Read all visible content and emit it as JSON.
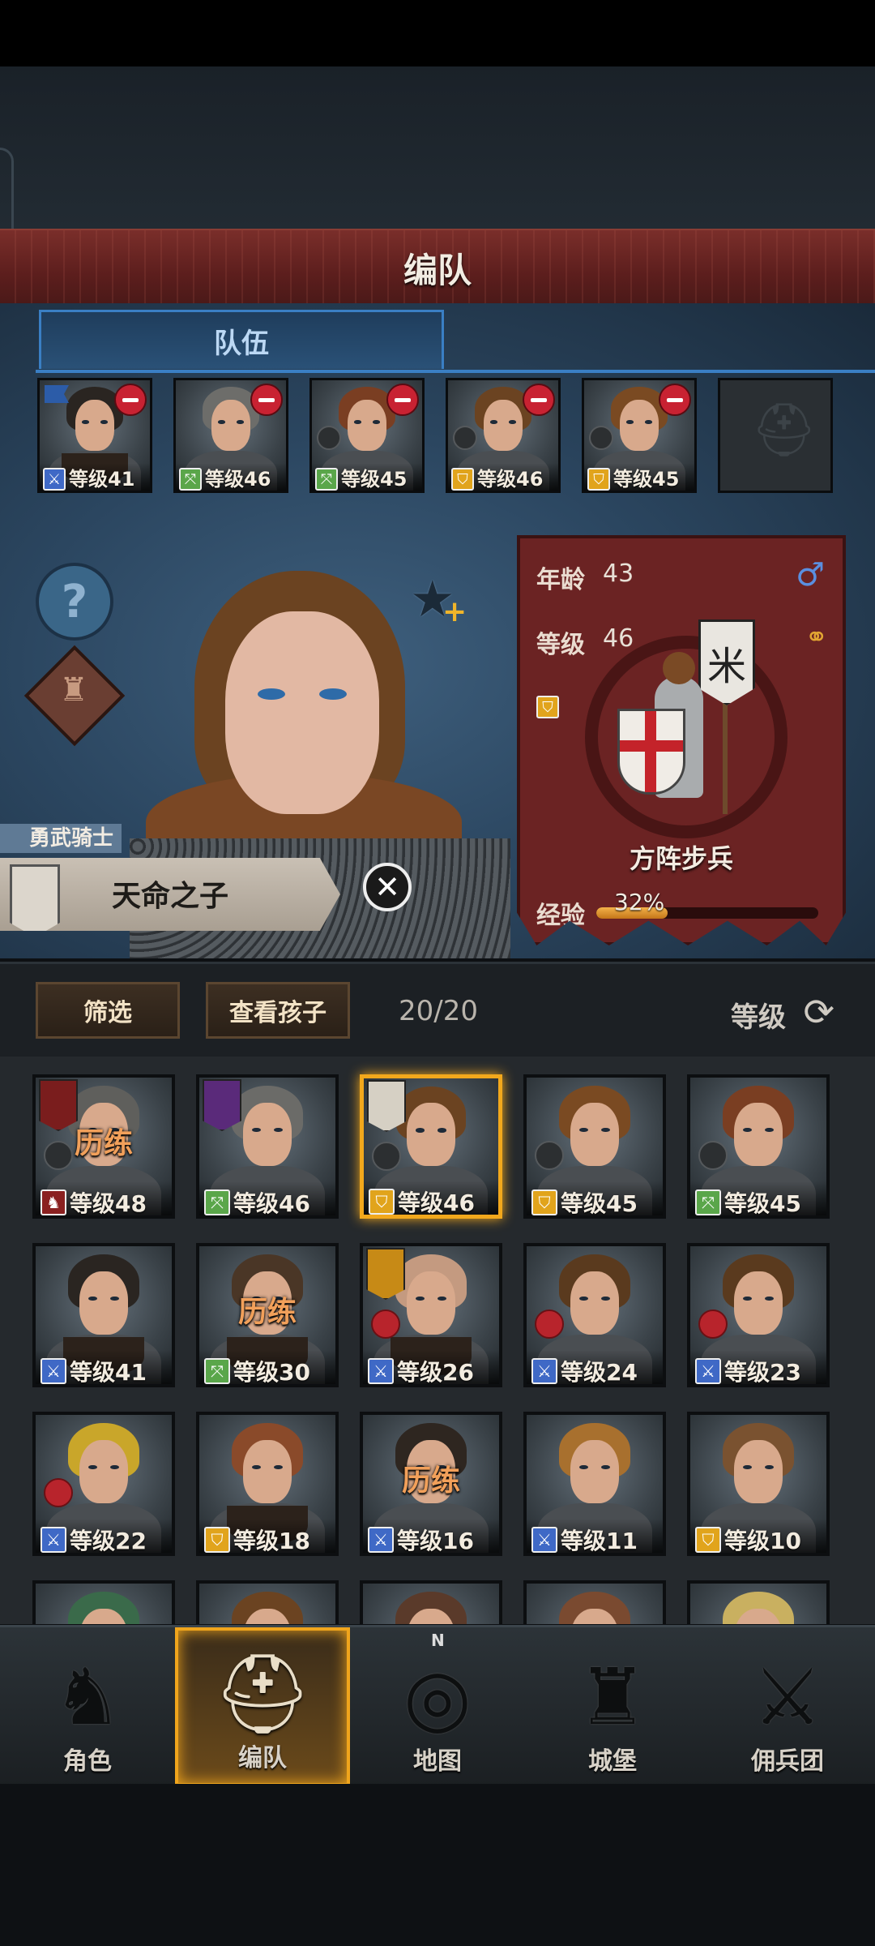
{
  "header": {
    "title": "编队"
  },
  "team": {
    "tab_label": "队伍",
    "slots": [
      {
        "level": "等级41",
        "class": "sword",
        "class_icon": "sword-icon",
        "hair": "#2a2521",
        "removable": true,
        "banner": true
      },
      {
        "level": "等级46",
        "class": "bow",
        "class_icon": "bow-icon",
        "hair": "#6d6d6a",
        "removable": true
      },
      {
        "level": "等级45",
        "class": "bow",
        "class_icon": "bow-icon",
        "hair": "#7a3e22",
        "removable": true
      },
      {
        "level": "等级46",
        "class": "shield",
        "class_icon": "shield-icon",
        "hair": "#6b4321",
        "removable": true
      },
      {
        "level": "等级45",
        "class": "shield",
        "class_icon": "shield-icon",
        "hair": "#7a4a22",
        "removable": true
      },
      {
        "empty": true
      }
    ]
  },
  "character": {
    "title": "勇武骑士",
    "name": "天命之子",
    "age_label": "年龄",
    "age": "43",
    "level_label": "等级",
    "level": "46",
    "unit_type": "方阵步兵",
    "exp_label": "经验",
    "exp_percent_text": "32%",
    "exp_fraction": 0.32,
    "gender_icon": "male-icon",
    "class_icon": "shield-icon"
  },
  "toolbar": {
    "filter_label": "筛选",
    "view_children_label": "查看孩子",
    "count": "20/20",
    "sort_label": "等级"
  },
  "roster": [
    {
      "level": "等级48",
      "class": "none",
      "bg": "grey",
      "training": "历练",
      "hair": "#5f5f5c",
      "heraldry": "#7a1d1d"
    },
    {
      "level": "等级46",
      "class": "bow",
      "bg": "gold",
      "hair": "#6b6b68",
      "heraldry": "#5a2a7a"
    },
    {
      "level": "等级46",
      "class": "shield",
      "bg": "gold",
      "selected": true,
      "hair": "#6b4321",
      "heraldry": "#d6d0c4"
    },
    {
      "level": "等级45",
      "class": "shield",
      "bg": "gold",
      "hair": "#7a4a22"
    },
    {
      "level": "等级45",
      "class": "bow",
      "bg": "gold",
      "hair": "#7a3e22"
    },
    {
      "level": "等级41",
      "class": "sword",
      "bg": "gold",
      "hair": "#2a2521",
      "beard": true
    },
    {
      "level": "等级30",
      "class": "bow",
      "bg": "grey",
      "training": "历练",
      "hair": "#4a3626",
      "beard": true
    },
    {
      "level": "等级26",
      "class": "sword",
      "bg": "grey",
      "hair": "#c49a80",
      "beard": true,
      "heraldry": "#c78a16",
      "redbadge": true
    },
    {
      "level": "等级24",
      "class": "sword",
      "bg": "grey",
      "hair": "#5a3a1e",
      "redbadge": true
    },
    {
      "level": "等级23",
      "class": "sword",
      "bg": "grey",
      "hair": "#5a3a1e",
      "redbadge": true
    },
    {
      "level": "等级22",
      "class": "sword",
      "bg": "grey",
      "hair": "#c9a62a",
      "redbadge": true
    },
    {
      "level": "等级18",
      "class": "shield",
      "bg": "grey",
      "hair": "#8a4a2a",
      "beard": true
    },
    {
      "level": "等级16",
      "class": "sword",
      "bg": "grey",
      "training": "历练",
      "hair": "#2e2620"
    },
    {
      "level": "等级11",
      "class": "sword",
      "bg": "grey",
      "hair": "#a8702e"
    },
    {
      "level": "等级10",
      "class": "shield",
      "bg": "grey",
      "hair": "#7a5230"
    }
  ],
  "nav": [
    {
      "label": "角色",
      "icon": "knight-icon"
    },
    {
      "label": "编队",
      "icon": "helmet-icon",
      "active": true
    },
    {
      "label": "地图",
      "icon": "compass-map-icon",
      "compass_letter": "N"
    },
    {
      "label": "城堡",
      "icon": "castle-icon"
    },
    {
      "label": "佣兵团",
      "icon": "mercenary-icon"
    }
  ],
  "colors": {
    "accent_gold": "#f2a81c",
    "tab_blue": "#3a7fc4",
    "stat_card_red": "#6b2323",
    "title_bar_red": "#7a2e2a"
  }
}
